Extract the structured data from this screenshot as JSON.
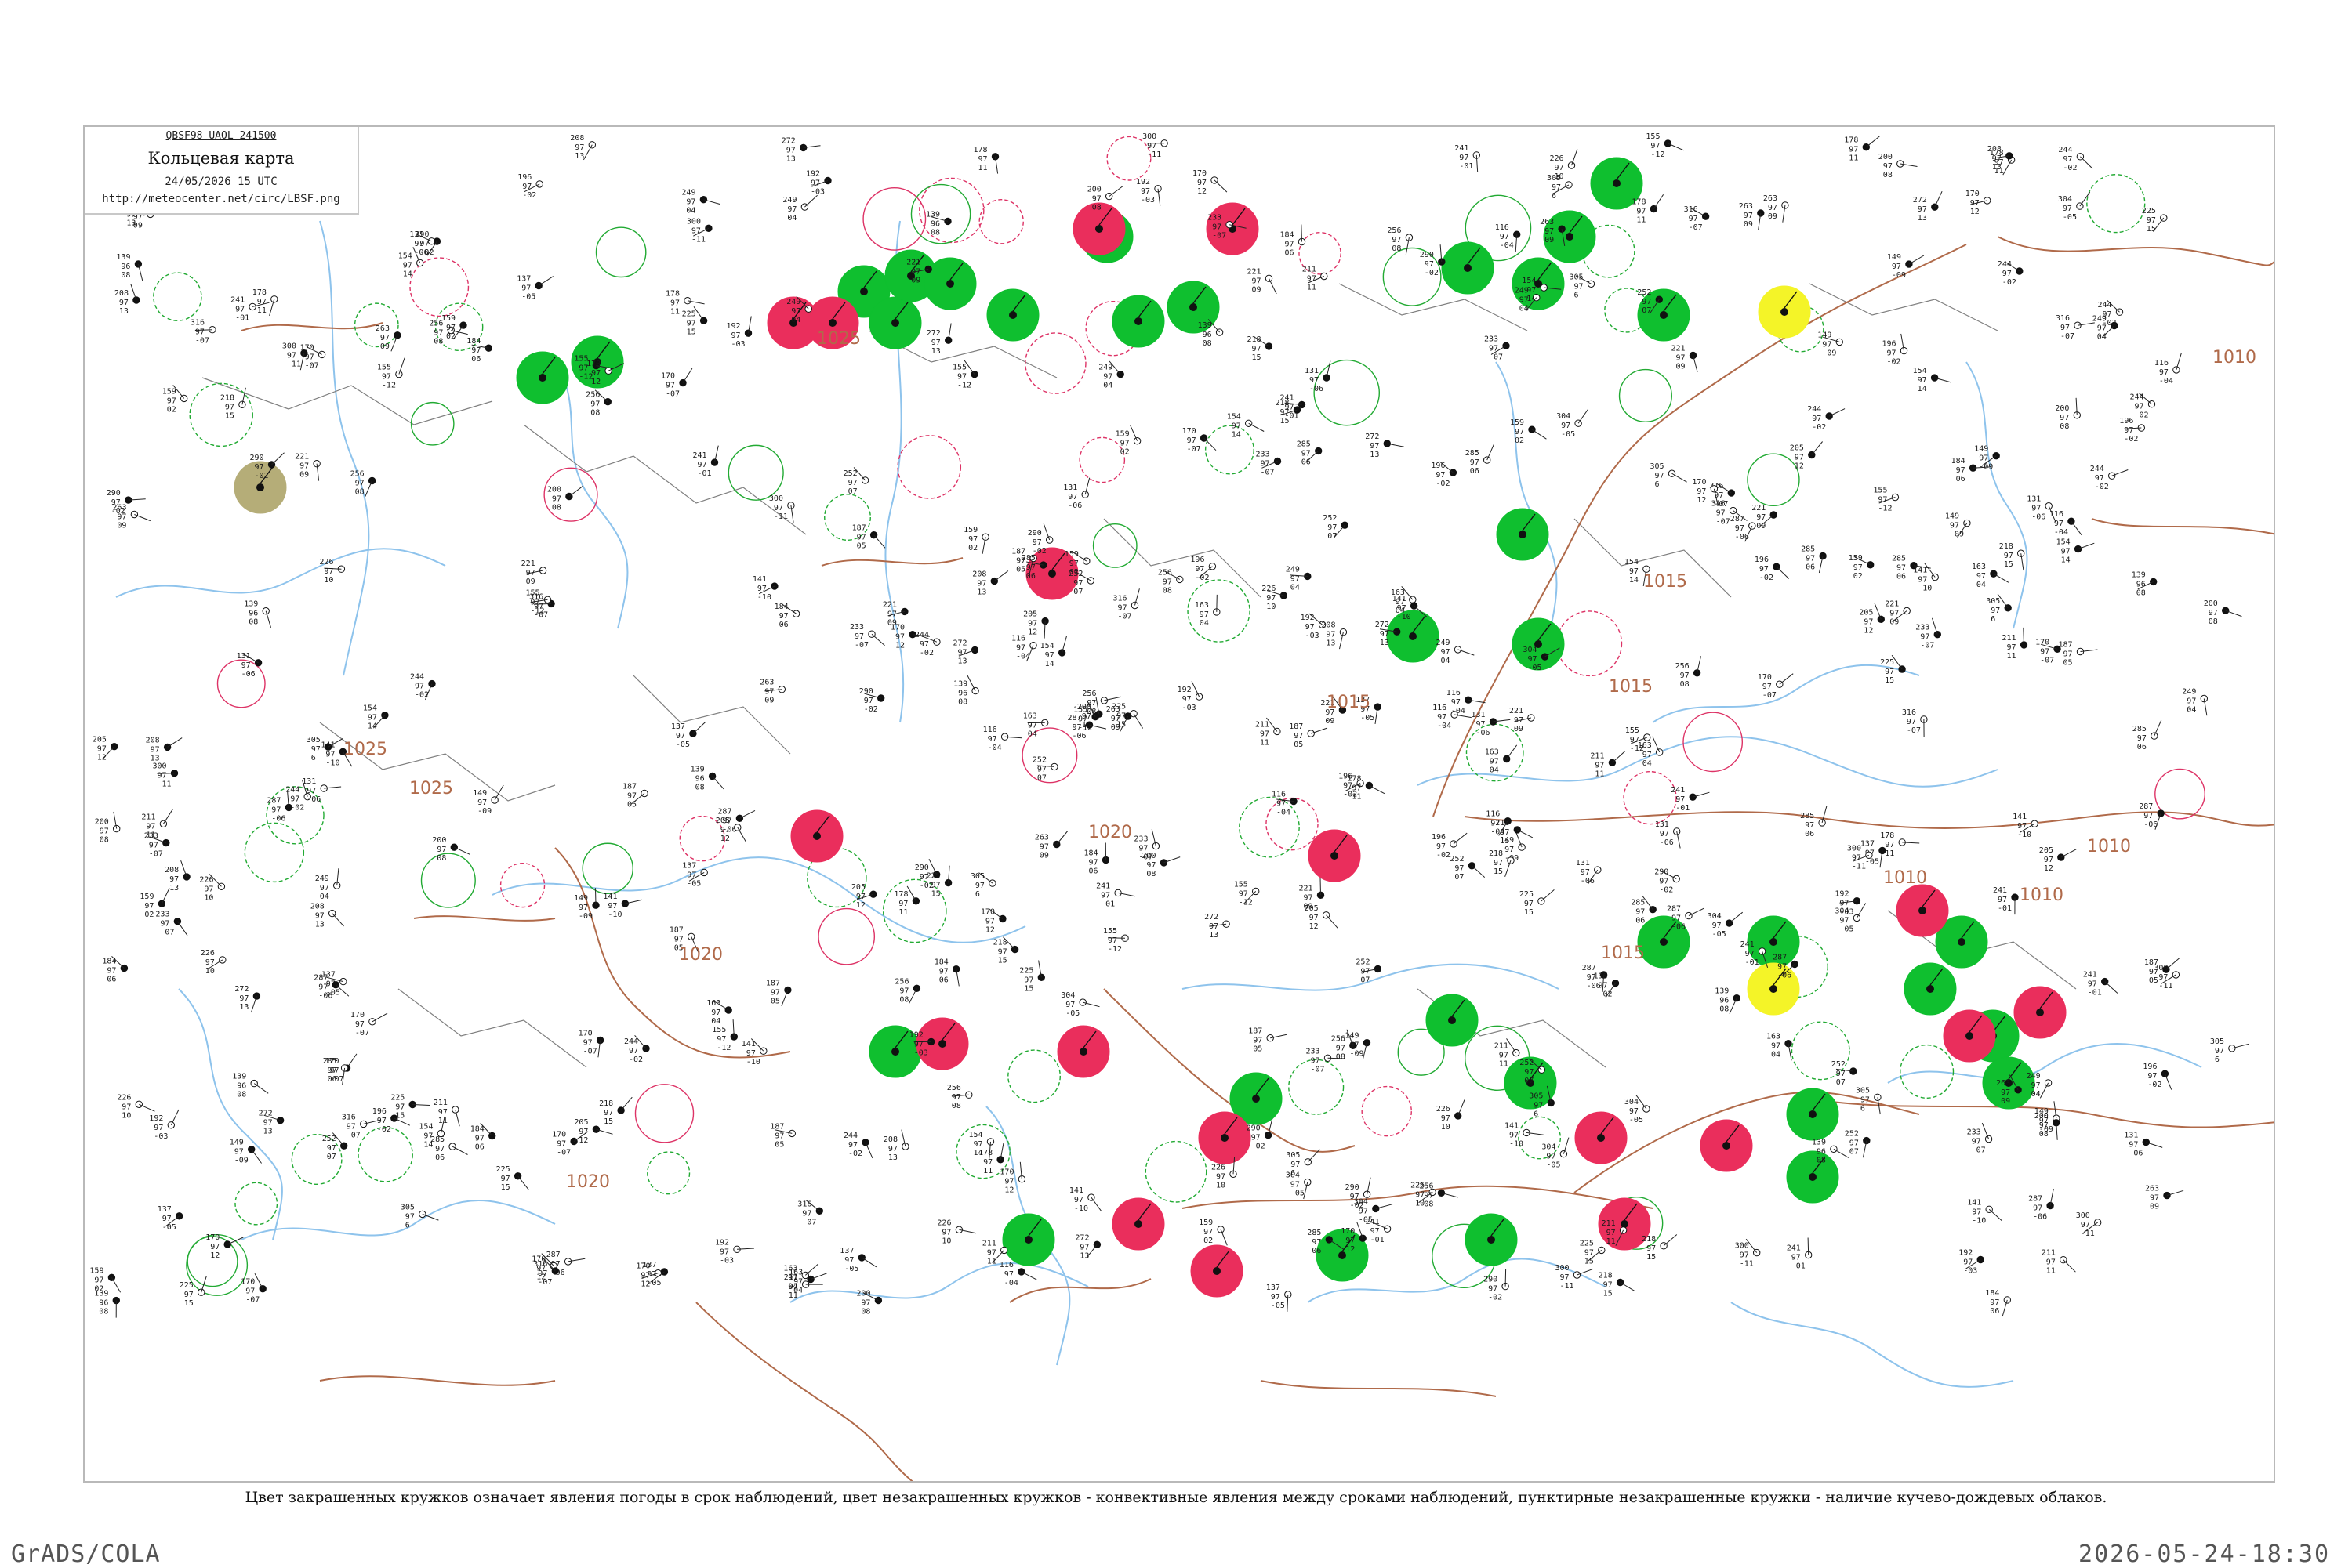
{
  "header": {
    "code": "QBSF98  UAOL  241500",
    "title": "Кольцевая карта",
    "datetime": "24/05/2026 15 UTC",
    "url": "http://meteocenter.net/circ/LBSF.png"
  },
  "caption": "Цвет закрашенных кружков означает явления погоды в срок наблюдений, цвет незакрашенных кружков - конвективные явления между сроками наблюдений, пунктирные незакрашенные кружки - наличие кучево-дождевых облаков.",
  "footer": {
    "left": "GrADS/COLA",
    "right": "2026-05-24-18:30"
  },
  "isobars": {
    "labels": [
      "1015",
      "1015",
      "1015",
      "1015",
      "1015",
      "1015",
      "1010",
      "1010",
      "1010",
      "1010",
      "1020",
      "1020",
      "1020",
      "1025",
      "1025",
      "1025"
    ]
  },
  "colors": {
    "rain": "#0fbf2f",
    "thunderstorm": "#ea2e5c",
    "shower_ring": "#22aa33",
    "thunder_ring": "#dd3366",
    "haze": "#b5ad78",
    "fog": "#f4f428",
    "isobar": "#b06a4a",
    "rivers": "#8ec3ec",
    "borders": "#7f7f7f"
  },
  "filled_circles": {
    "green": 33,
    "red": 18,
    "yellow": 2,
    "olive": 1
  },
  "stations_sample": [
    {
      "pressure": "241",
      "temp": "97",
      "dew": "-01"
    },
    {
      "pressure": "305",
      "temp": "97",
      "dew": "6"
    },
    {
      "pressure": "290",
      "temp": "97",
      "dew": "-02"
    },
    {
      "pressure": "263",
      "temp": "97",
      "dew": "09"
    },
    {
      "pressure": "256",
      "temp": "97",
      "dew": "08"
    },
    {
      "pressure": "244",
      "temp": "97",
      "dew": "-02"
    },
    {
      "pressure": "211",
      "temp": "97",
      "dew": "11"
    },
    {
      "pressure": "252",
      "temp": "97",
      "dew": "07"
    },
    {
      "pressure": "196",
      "temp": "97",
      "dew": "-02"
    },
    {
      "pressure": "225",
      "temp": "97",
      "dew": "15"
    },
    {
      "pressure": "170",
      "temp": "97",
      "dew": "12"
    },
    {
      "pressure": "139",
      "temp": "96",
      "dew": "08"
    },
    {
      "pressure": "155",
      "temp": "97",
      "dew": "-12"
    },
    {
      "pressure": "287",
      "temp": "97",
      "dew": "-06"
    },
    {
      "pressure": "316",
      "temp": "97",
      "dew": "-07"
    },
    {
      "pressure": "272",
      "temp": "97",
      "dew": "13"
    },
    {
      "pressure": "285",
      "temp": "97",
      "dew": "06"
    },
    {
      "pressure": "304",
      "temp": "97",
      "dew": "-05"
    },
    {
      "pressure": "249",
      "temp": "97",
      "dew": "04"
    },
    {
      "pressure": "221",
      "temp": "97",
      "dew": "09"
    },
    {
      "pressure": "233",
      "temp": "97",
      "dew": "-07"
    },
    {
      "pressure": "200",
      "temp": "97",
      "dew": "08"
    },
    {
      "pressure": "187",
      "temp": "97",
      "dew": "05"
    },
    {
      "pressure": "163",
      "temp": "97",
      "dew": "04"
    },
    {
      "pressure": "178",
      "temp": "97",
      "dew": "11"
    },
    {
      "pressure": "154",
      "temp": "97",
      "dew": "14"
    },
    {
      "pressure": "131",
      "temp": "97",
      "dew": "-06"
    },
    {
      "pressure": "116",
      "temp": "97",
      "dew": "-04"
    },
    {
      "pressure": "300",
      "temp": "97",
      "dew": "-11"
    },
    {
      "pressure": "149",
      "temp": "97",
      "dew": "-09"
    },
    {
      "pressure": "226",
      "temp": "97",
      "dew": "10"
    },
    {
      "pressure": "208",
      "temp": "97",
      "dew": "13"
    },
    {
      "pressure": "192",
      "temp": "97",
      "dew": "-03"
    },
    {
      "pressure": "170",
      "temp": "97",
      "dew": "-07"
    },
    {
      "pressure": "141",
      "temp": "97",
      "dew": "-10"
    },
    {
      "pressure": "184",
      "temp": "97",
      "dew": "06"
    },
    {
      "pressure": "159",
      "temp": "97",
      "dew": "02"
    },
    {
      "pressure": "218",
      "temp": "97",
      "dew": "15"
    },
    {
      "pressure": "137",
      "temp": "97",
      "dew": "-05"
    },
    {
      "pressure": "205",
      "temp": "97",
      "dew": "12"
    }
  ]
}
